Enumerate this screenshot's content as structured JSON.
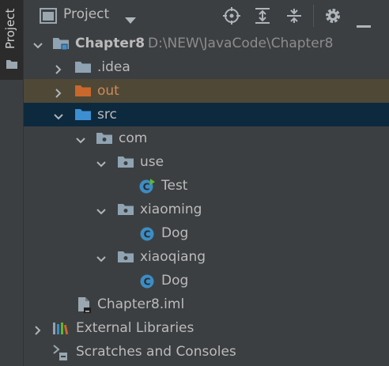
{
  "sidebar": {
    "tab_label": "Project"
  },
  "header": {
    "title": "Project"
  },
  "tree": {
    "root_name": "Chapter8",
    "root_path": "D:\\NEW\\JavaCode\\Chapter8",
    "idea": ".idea",
    "out": "out",
    "src": "src",
    "com": "com",
    "use": "use",
    "test": "Test",
    "xiaoming": "xiaoming",
    "dog1": "Dog",
    "xiaoqiang": "xiaoqiang",
    "dog2": "Dog",
    "iml": "Chapter8.iml",
    "external": "External Libraries",
    "scratches": "Scratches and Consoles"
  },
  "colors": {
    "panel_bg": "#3c3f41",
    "selected_src": "#0d293e",
    "selected_out": "#4f4837",
    "folder": "#8fa3b3",
    "source_folder": "#3d8fd1",
    "excluded_folder": "#c8682c",
    "class_icon": "#3c8dc5"
  }
}
